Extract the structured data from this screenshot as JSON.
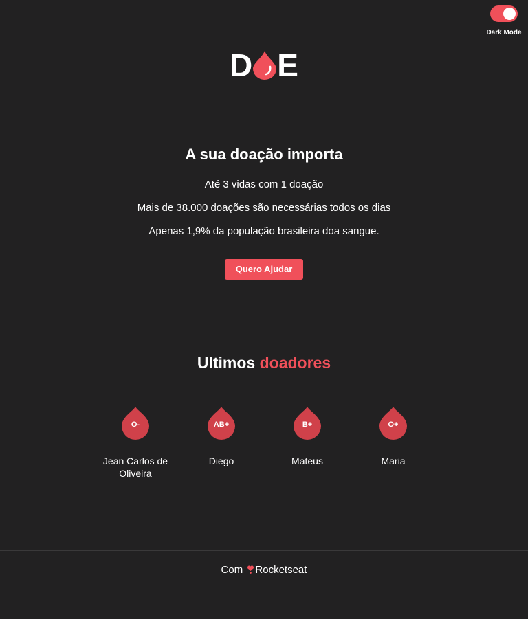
{
  "theme_toggle": {
    "label": "Dark Mode",
    "state": "on"
  },
  "logo": {
    "left": "D",
    "right": "E",
    "drop_icon": "blood-drop-icon"
  },
  "hero": {
    "title": "A sua doação importa",
    "lines": [
      "Até 3 vidas com 1 doação",
      "Mais de 38.000 doações são necessárias todos os dias",
      "Apenas 1,9% da população brasileira doa sangue."
    ],
    "cta_label": "Quero Ajudar"
  },
  "donors": {
    "title": "Ultimos",
    "title_accent": "doadores",
    "items": [
      {
        "blood_type": "O-",
        "name": "Jean Carlos de Oliveira"
      },
      {
        "blood_type": "AB+",
        "name": "Diego"
      },
      {
        "blood_type": "B+",
        "name": "Mateus"
      },
      {
        "blood_type": "O+",
        "name": "Maria"
      }
    ]
  },
  "footer": {
    "prefix": "Com",
    "icon": "heart-icon",
    "brand": "Rocketseat"
  },
  "colors": {
    "accent": "#f0505a",
    "drop": "#d0414a",
    "background": "#222122"
  }
}
